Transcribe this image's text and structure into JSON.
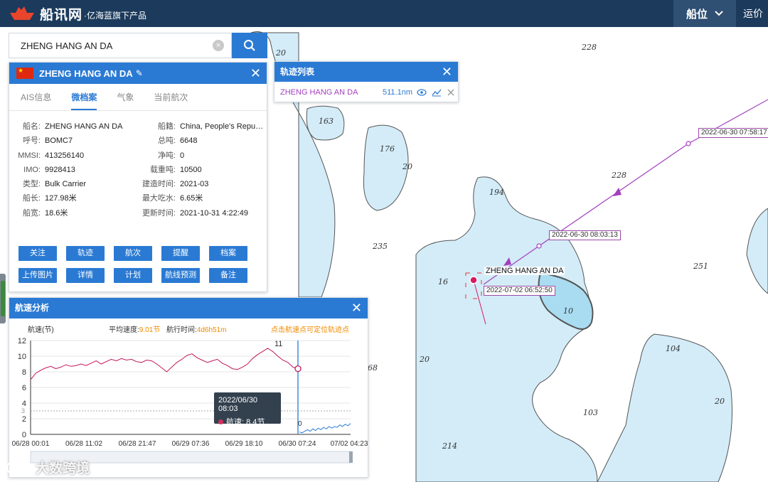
{
  "header": {
    "brand": "船讯网",
    "brand_sub": "·亿海蓝旗下产品",
    "nav_ship": "船位",
    "nav_yunli": "运价"
  },
  "search": {
    "value": "ZHENG HANG AN DA",
    "clear": "×"
  },
  "ship": {
    "name": "ZHENG HANG AN DA",
    "tabs": [
      "AIS信息",
      "微档案",
      "气象",
      "当前航次"
    ],
    "active_tab": "微档案",
    "info": [
      {
        "k1": "船名:",
        "v1": "ZHENG HANG AN DA",
        "k2": "船籍:",
        "v2": "China, People's Republic..."
      },
      {
        "k1": "呼号:",
        "v1": "BOMC7",
        "k2": "总吨:",
        "v2": "6648"
      },
      {
        "k1": "MMSI:",
        "v1": "413256140",
        "k2": "净吨:",
        "v2": "0"
      },
      {
        "k1": "IMO:",
        "v1": "9928413",
        "k2": "载重吨:",
        "v2": "10500"
      },
      {
        "k1": "类型:",
        "v1": "Bulk Carrier",
        "k2": "建造时间:",
        "v2": "2021-03"
      },
      {
        "k1": "船长:",
        "v1": "127.98米",
        "k2": "最大吃水:",
        "v2": "6.65米"
      },
      {
        "k1": "船宽:",
        "v1": "18.6米",
        "k2": "更新时间:",
        "v2": "2021-10-31 4:22:49"
      }
    ],
    "buttons": [
      "关注",
      "轨迹",
      "航次",
      "提醒",
      "档案",
      "上传图片",
      "详情",
      "计划",
      "航线预测",
      "备注"
    ]
  },
  "track_list": {
    "title": "轨迹列表",
    "items": [
      {
        "name": "ZHENG HANG AN DA",
        "distance": "511.1nm"
      }
    ]
  },
  "speed": {
    "title": "航速分析",
    "y_label": "航速(节)",
    "avg_label": "平均速度:",
    "avg_value": "9.01节",
    "time_label": "航行时间:",
    "time_value": "4d6h51m",
    "hint": "点击航速点可定位轨迹点",
    "tooltip_time": "2022/06/30 08:03",
    "tooltip_speed": "航速:  8.4节",
    "max_label": "11",
    "min_label": "0",
    "ref_line": "3"
  },
  "chart_data": {
    "type": "line",
    "title": "航速分析",
    "ylabel": "航速(节)",
    "ylim": [
      0,
      12
    ],
    "yticks": [
      0,
      2,
      4,
      6,
      8,
      10,
      12
    ],
    "xticks": [
      "06/28 00:01",
      "06/28 11:02",
      "06/28 21:47",
      "06/29 07:36",
      "06/29 18:10",
      "06/30 07:24",
      "07/02 04:23"
    ],
    "series": [
      {
        "color": "#c2185b",
        "values": [
          7.0,
          7.8,
          8.2,
          8.5,
          8.7,
          8.4,
          8.6,
          8.9,
          8.7,
          8.8,
          9.0,
          8.8,
          9.1,
          9.4,
          9.0,
          9.3,
          9.6,
          9.4,
          9.7,
          9.5,
          9.6,
          9.3,
          9.2,
          9.5,
          9.4,
          9.0,
          8.5,
          8.0,
          8.6,
          9.2,
          9.6,
          10.1,
          10.3,
          9.8,
          9.5,
          9.2,
          9.4,
          9.6,
          9.1,
          8.8,
          8.4,
          8.3,
          8.6,
          9.0,
          9.7,
          10.2,
          10.6,
          11.0,
          10.6,
          10.0,
          9.5,
          9.2,
          8.6,
          8.4
        ]
      },
      {
        "color": "#2a7ad4",
        "values": [
          0.3,
          0.2,
          0.4,
          0.6,
          0.4,
          0.7,
          0.5,
          0.8,
          0.6,
          0.9,
          0.7,
          1.0,
          0.8,
          1.0,
          0.9,
          1.2,
          1.0,
          1.3,
          1.1,
          1.4
        ]
      }
    ],
    "markers": [
      {
        "label": "11",
        "value": 11
      },
      {
        "label": "0",
        "value": 0
      }
    ],
    "selected": {
      "time": "2022/06/30 08:03",
      "speed": 8.4
    }
  },
  "map": {
    "track_labels": [
      "2022-06-30 07:58:17",
      "2022-06-30 08:03:13",
      "2022-07-02 06:52:50"
    ],
    "ship_label": "ZHENG HANG AN DA",
    "depths": [
      "20",
      "228",
      "163",
      "176",
      "20",
      "228",
      "194",
      "235",
      "16",
      "10",
      "251",
      "20",
      "104",
      "68",
      "103",
      "214",
      "20"
    ]
  },
  "watermark": "大数跨境"
}
